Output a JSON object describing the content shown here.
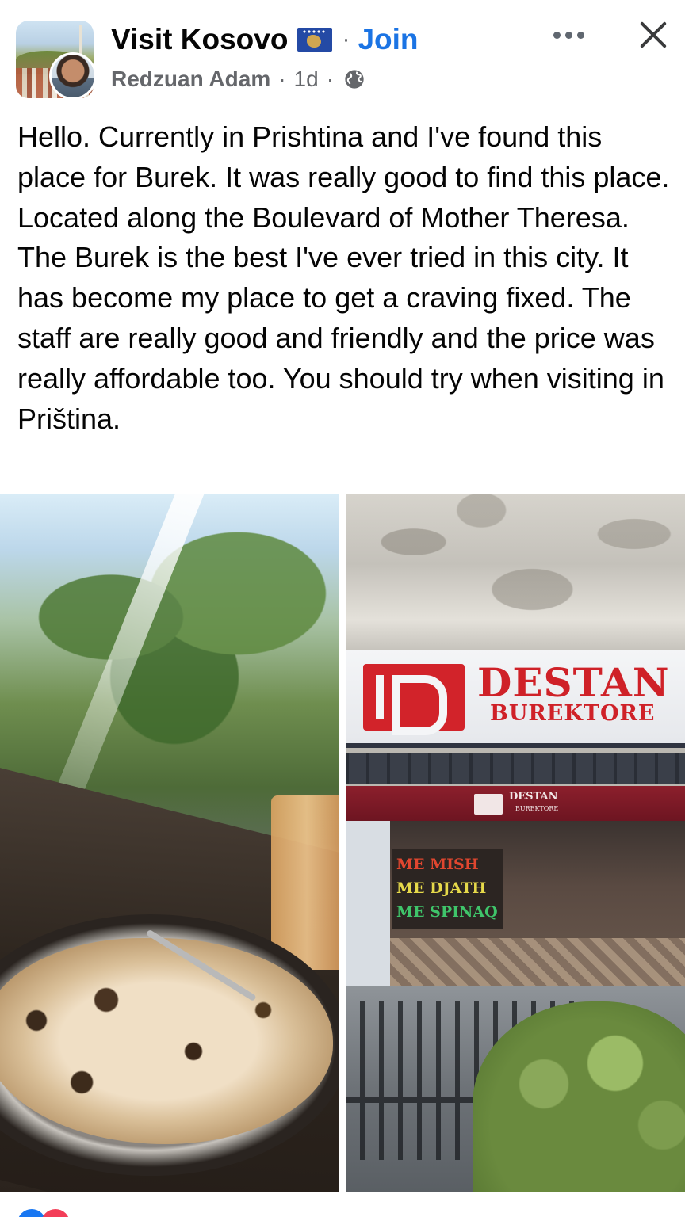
{
  "header": {
    "group_name": "Visit Kosovo",
    "separator": "·",
    "join_label": "Join",
    "author": "Redzuan Adam",
    "time": "1d",
    "meta_separator": "·",
    "visibility_icon": "globe-icon",
    "more_icon": "more-horizontal-icon",
    "close_icon": "close-icon",
    "flag_icon": "kosovo-flag-icon"
  },
  "post": {
    "text": "Hello. Currently in Prishtina and I've found this place for Burek. It was really good to find this place. Located along the Boulevard of Mother Theresa. The Burek is the best I've ever tried in this city. It has become my place to get a craving fixed. The staff are really good and friendly and the price was really affordable too. You should try when visiting in Priština."
  },
  "photos": {
    "right": {
      "sign_title": "DESTAN",
      "sign_subtitle": "BUREKTORE",
      "canopy_title": "DESTAN",
      "canopy_subtitle": "BUREKTORE",
      "menu_lines": [
        "ME MISH",
        "ME DJATH",
        "ME SPINAQ"
      ]
    }
  },
  "colors": {
    "link": "#1b74e4",
    "secondary_text": "#65676b",
    "brand_red": "#cf2128"
  }
}
